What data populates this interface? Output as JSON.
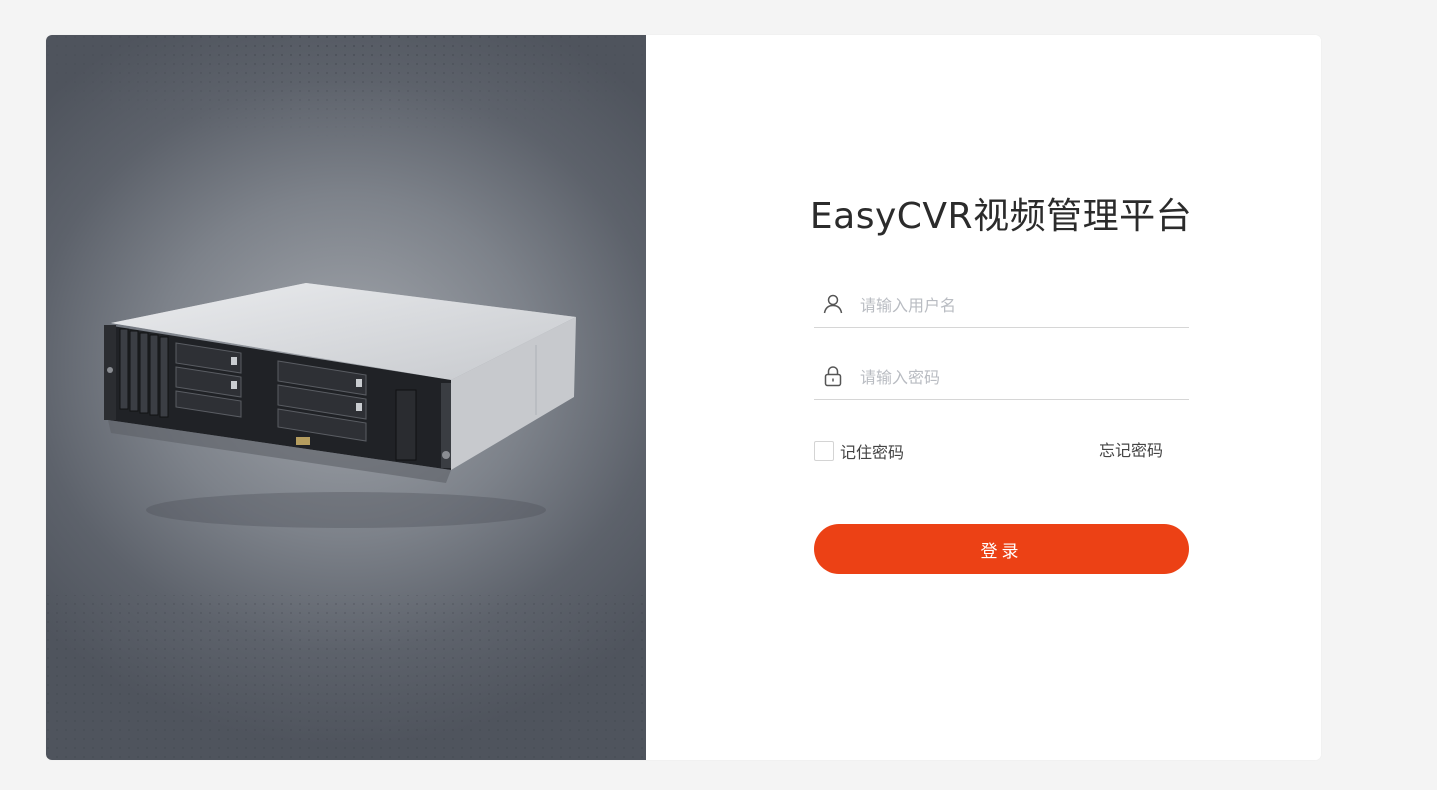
{
  "app": {
    "title": "EasyCVR视频管理平台"
  },
  "login_form": {
    "username": {
      "value": "",
      "placeholder": "请输入用户名",
      "icon": "user-icon"
    },
    "password": {
      "value": "",
      "placeholder": "请输入密码",
      "icon": "lock-icon"
    },
    "remember_label": "记住密码",
    "remember_checked": false,
    "forgot_label": "忘记密码",
    "login_label": "登录"
  },
  "colors": {
    "accent": "#ec4115",
    "page_background": "#f4f4f4",
    "panel_background": "#ffffff"
  }
}
